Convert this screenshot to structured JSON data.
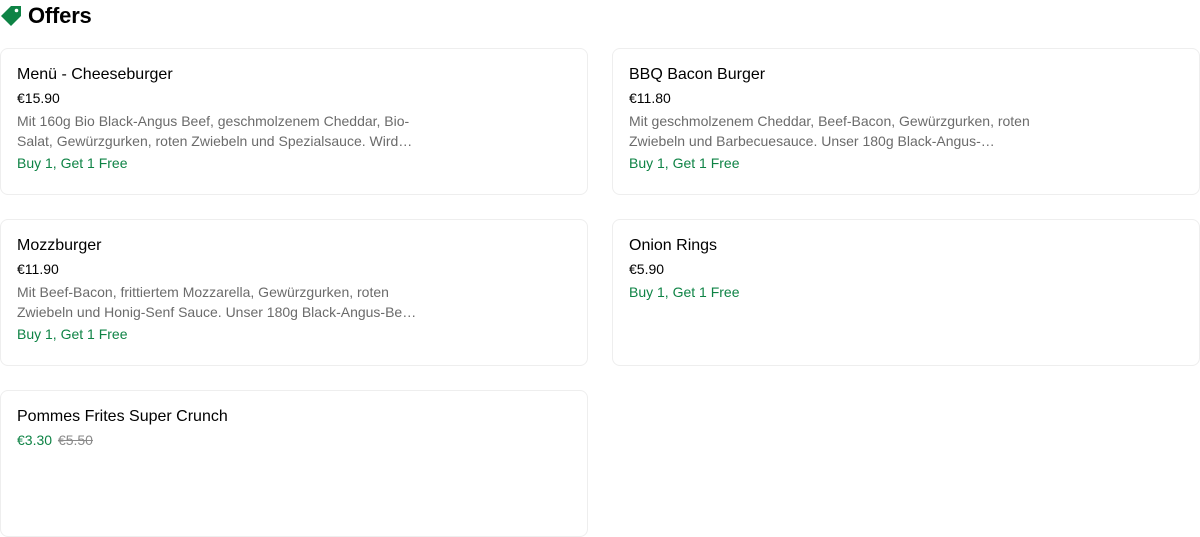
{
  "header": {
    "title": "Offers"
  },
  "colors": {
    "accent_green": "#0e8345",
    "muted_text": "#6b6b6b",
    "card_border": "#eeeeee"
  },
  "offers": [
    {
      "name": "Menü - Cheeseburger",
      "price": "€15.90",
      "description": "Mit 160g Bio Black-Angus Beef, geschmolzenem Cheddar, Bio-Salat, Gewürzgurken, roten Zwiebeln und Spezialsauce. Wird…",
      "promo": "Buy 1, Get 1 Free"
    },
    {
      "name": "BBQ Bacon Burger",
      "price": "€11.80",
      "description": "Mit geschmolzenem Cheddar, Beef-Bacon, Gewürzgurken, roten Zwiebeln und Barbecuesauce. Unser 180g Black-Angus-…",
      "promo": "Buy 1, Get 1 Free"
    },
    {
      "name": "Mozzburger",
      "price": "€11.90",
      "description": "Mit Beef-Bacon, frittiertem Mozzarella, Gewürzgurken, roten Zwiebeln und Honig-Senf Sauce. Unser 180g Black-Angus-Be…",
      "promo": "Buy 1, Get 1 Free"
    },
    {
      "name": "Onion Rings",
      "price": "€5.90",
      "promo": "Buy 1, Get 1 Free"
    },
    {
      "name": "Pommes Frites Super Crunch",
      "sale_price": "€3.30",
      "original_price": "€5.50"
    }
  ]
}
